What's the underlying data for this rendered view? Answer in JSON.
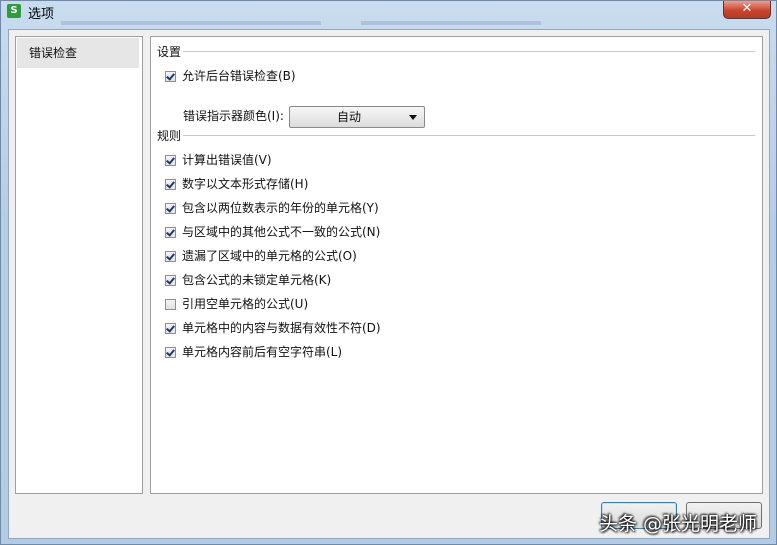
{
  "window": {
    "title": "选项",
    "app_icon_letter": "S",
    "close_glyph": "✕"
  },
  "nav": {
    "items": [
      {
        "label": "错误检查",
        "selected": true
      }
    ]
  },
  "settings": {
    "header": "设置",
    "background_check": {
      "label": "允许后台错误检查(B)",
      "checked": true
    },
    "indicator_color": {
      "label": "错误指示器颜色(I):",
      "value": "自动"
    }
  },
  "rules": {
    "header": "规则",
    "items": [
      {
        "label": "计算出错误值(V)",
        "checked": true
      },
      {
        "label": "数字以文本形式存储(H)",
        "checked": true
      },
      {
        "label": "包含以两位数表示的年份的单元格(Y)",
        "checked": true
      },
      {
        "label": "与区域中的其他公式不一致的公式(N)",
        "checked": true
      },
      {
        "label": "遗漏了区域中的单元格的公式(O)",
        "checked": true
      },
      {
        "label": "包含公式的未锁定单元格(K)",
        "checked": true
      },
      {
        "label": "引用空单元格的公式(U)",
        "checked": false
      },
      {
        "label": "单元格中的内容与数据有效性不符(D)",
        "checked": true
      },
      {
        "label": "单元格内容前后有空字符串(L)",
        "checked": true
      }
    ]
  },
  "buttons": {
    "ok_label": "",
    "cancel_label": ""
  },
  "watermark": "头条 @张光明老师"
}
